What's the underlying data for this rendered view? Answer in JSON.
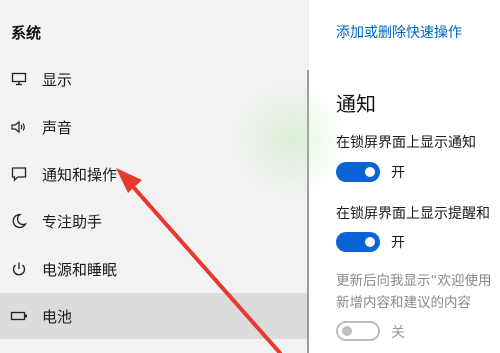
{
  "sidebar": {
    "title": "系统",
    "items": [
      {
        "label": "显示",
        "icon": "monitor-icon"
      },
      {
        "label": "声音",
        "icon": "speaker-icon"
      },
      {
        "label": "通知和操作",
        "icon": "notification-icon"
      },
      {
        "label": "专注助手",
        "icon": "moon-icon"
      },
      {
        "label": "电源和睡眠",
        "icon": "power-icon"
      },
      {
        "label": "电池",
        "icon": "battery-icon"
      }
    ],
    "selected": "电池"
  },
  "main": {
    "link": "添加或删除快速操作",
    "section_title": "通知",
    "settings": [
      {
        "label": "在锁屏界面上显示通知",
        "toggle": "开",
        "on": true
      },
      {
        "label": "在锁屏界面上显示提醒和",
        "toggle": "开",
        "on": true
      },
      {
        "label_lines": [
          "更新后向我显示“欢迎使用",
          "新增内容和建议的内容"
        ],
        "toggle": "关",
        "on": false
      }
    ]
  },
  "annotation": {
    "color": "#e8392f"
  },
  "colors": {
    "accent": "#0a64d6",
    "link": "#0067c0",
    "sidebar_bg": "#f2f2f2",
    "selected_bg": "#dcdcdc"
  }
}
